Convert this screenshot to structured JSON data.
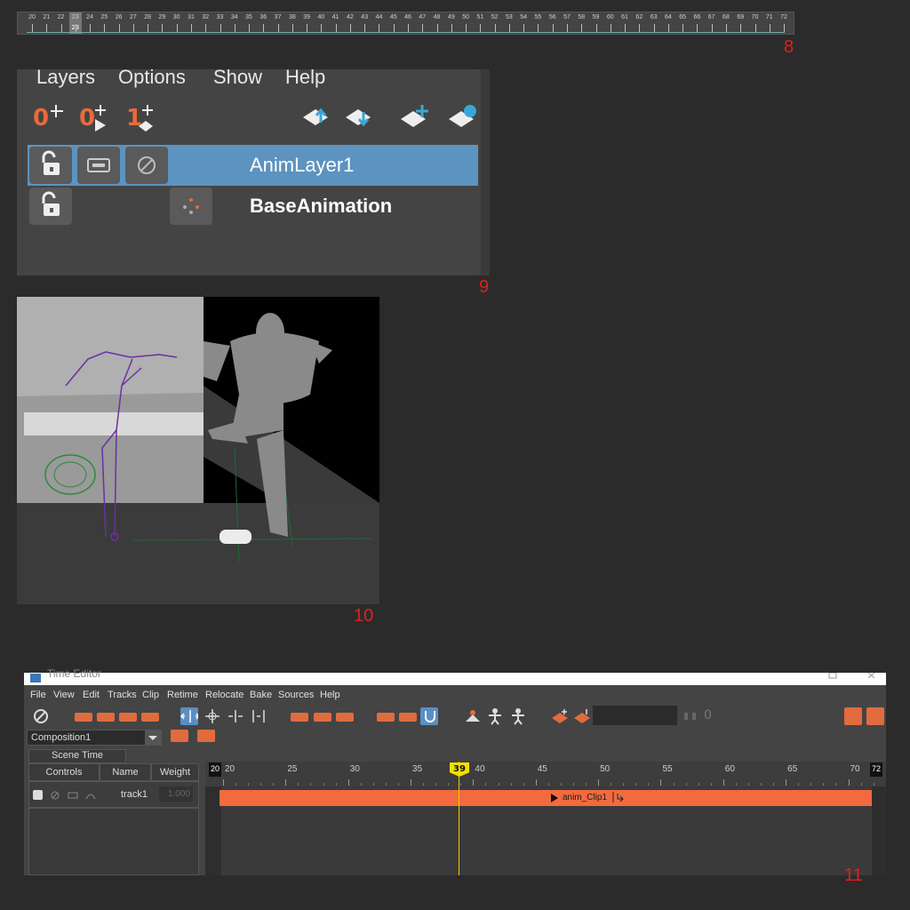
{
  "panel_numbers": {
    "p8": "8",
    "p9": "9",
    "p10": "10",
    "p11": "11"
  },
  "time_slider": {
    "frames": [
      "20",
      "21",
      "22",
      "23",
      "24",
      "25",
      "26",
      "27",
      "28",
      "29",
      "30",
      "31",
      "32",
      "33",
      "34",
      "35",
      "36",
      "37",
      "38",
      "39",
      "40",
      "41",
      "42",
      "43",
      "44",
      "45",
      "46",
      "47",
      "48",
      "49",
      "50",
      "51",
      "52",
      "53",
      "54",
      "55",
      "56",
      "57",
      "58",
      "59",
      "60",
      "61",
      "62",
      "63",
      "64",
      "65",
      "66",
      "67",
      "68",
      "69",
      "70",
      "71",
      "72"
    ],
    "current_frame": "23"
  },
  "anim_layer_editor": {
    "menu": [
      "Layers",
      "Options",
      "Show",
      "Help"
    ],
    "toolbar_labels": [
      "0",
      "0",
      "1"
    ],
    "layers": [
      {
        "name": "AnimLayer1",
        "selected": true
      },
      {
        "name": "BaseAnimation",
        "selected": false
      }
    ]
  },
  "time_editor": {
    "title": "Time Editor",
    "menu": [
      "File",
      "View",
      "Edit",
      "Tracks",
      "Clip",
      "Retime",
      "Relocate",
      "Bake",
      "Sources",
      "Help"
    ],
    "composition": "Composition1",
    "scene_time_tab": "Scene Time",
    "columns": [
      "Controls",
      "Name",
      "Weight"
    ],
    "track": {
      "name": "track1",
      "weight": "1.000"
    },
    "ruler_labels": [
      "20",
      "25",
      "30",
      "35",
      "40",
      "45",
      "50",
      "55",
      "60",
      "65",
      "70"
    ],
    "start_frame": "20",
    "end_frame": "72",
    "current_frame": "39",
    "clip_name": "anim_Clip1",
    "offset_label": "0"
  },
  "colors": {
    "clip": "#f26a3e",
    "selection": "#5d93c0",
    "playhead": "#f0e000",
    "panel_number": "#e0201a"
  }
}
